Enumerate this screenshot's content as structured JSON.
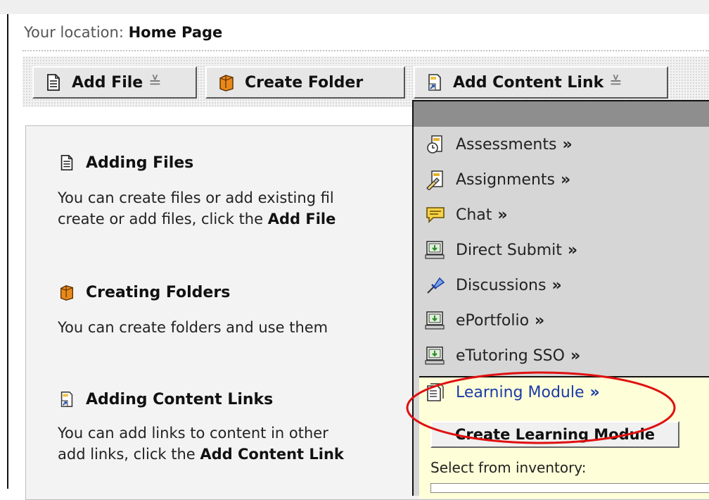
{
  "location": {
    "label": "Your location:",
    "page": "Home Page"
  },
  "toolbar": {
    "add_file": "Add File",
    "create_folder": "Create Folder",
    "add_content_link": "Add Content Link"
  },
  "sections": {
    "adding_files": {
      "title": "Adding Files",
      "line1": "You can create files or add existing fil",
      "line2_pre": "create or add files, click the ",
      "line2_bold": "Add File"
    },
    "creating_folders": {
      "title": "Creating Folders",
      "line1": "You can create folders and use them"
    },
    "adding_links": {
      "title": "Adding Content Links",
      "line1": "You can add links to content in other",
      "line2_pre": "add links, click the ",
      "line2_bold": "Add Content Link"
    }
  },
  "dropdown": {
    "items": [
      {
        "label": "Assessments",
        "arrow": "»",
        "icon": "assessments-icon"
      },
      {
        "label": "Assignments",
        "arrow": "»",
        "icon": "assignments-icon"
      },
      {
        "label": "Chat",
        "arrow": "»",
        "icon": "chat-icon"
      },
      {
        "label": "Direct Submit",
        "arrow": "»",
        "icon": "direct-submit-icon"
      },
      {
        "label": "Discussions",
        "arrow": "»",
        "icon": "discussions-icon"
      },
      {
        "label": "ePortfolio",
        "arrow": "»",
        "icon": "eportfolio-icon"
      },
      {
        "label": "eTutoring SSO",
        "arrow": "»",
        "icon": "etutoring-icon"
      }
    ],
    "learning_module": {
      "label": "Learning Module",
      "arrow": "»"
    },
    "create_button": "Create Learning Module",
    "select_label": "Select from inventory:"
  },
  "colors": {
    "highlight_bg": "#fefed8",
    "link": "#1a3aa8",
    "annotation": "#e01010"
  }
}
